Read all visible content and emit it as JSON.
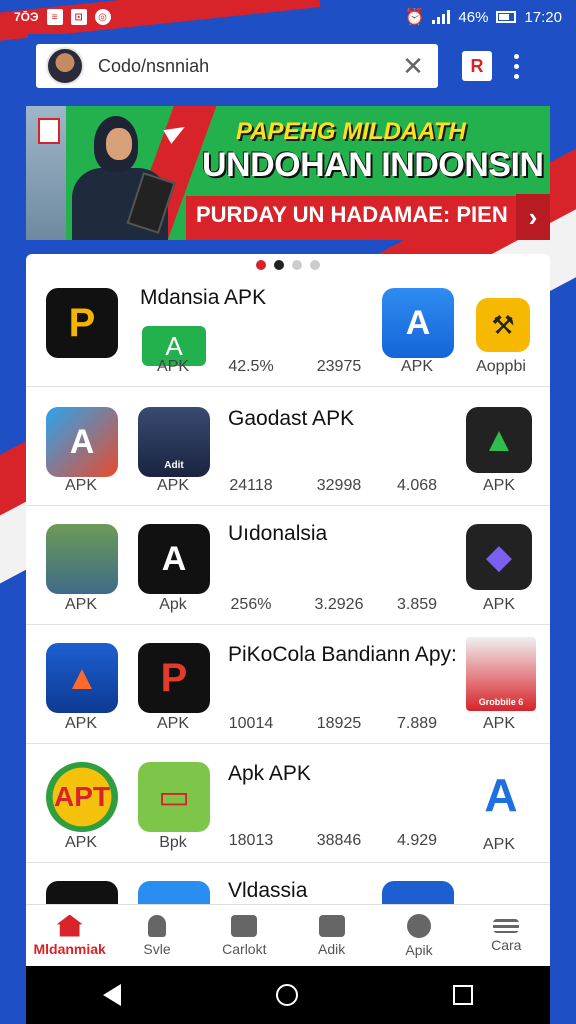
{
  "status_bar": {
    "left_icons": [
      "7ŌЭ",
      "≡",
      "⊡",
      "◎"
    ],
    "battery": "46%",
    "time": "17:20"
  },
  "search": {
    "value": "Codo/nsnniah"
  },
  "banner": {
    "line1": "PAPEHG MILDAATH",
    "line2": "UNDOHAN INDONSIN",
    "line3": "PURDAY UN HADAMAE: PIEN"
  },
  "rows": [
    {
      "title": "Mdansia  APK",
      "left_icon": "p-logo-icon",
      "captions": [
        "APK",
        "APK",
        "Aoppbi"
      ],
      "stats": [
        "42.5%",
        "23975"
      ]
    },
    {
      "title": "Gaodast APK",
      "captions": [
        "APK",
        "APK",
        "APK"
      ],
      "person_label": "Adit",
      "stats": [
        "24118",
        "32998",
        "4.068"
      ]
    },
    {
      "title": "Uıdonalsia",
      "captions": [
        "APK",
        "Apk",
        "APK"
      ],
      "stats": [
        "256%",
        "3.2926",
        "3.859"
      ]
    },
    {
      "title": "PiKoCola Bandiann Apy:",
      "captions": [
        "APK",
        "APK",
        "APK"
      ],
      "person_label": "Grobbile 6",
      "stats": [
        "10014",
        "18925",
        "7.889"
      ]
    },
    {
      "title": "Apk APK",
      "icon_text": "APT",
      "captions": [
        "APK",
        "Bpk",
        "APK"
      ],
      "stats": [
        "18013",
        "38846",
        "4.929"
      ]
    },
    {
      "title": "Vldassia"
    }
  ],
  "bottom_nav": [
    {
      "label": "Mldanmiak",
      "icon": "home-icon"
    },
    {
      "label": "Svle",
      "icon": "lock-icon"
    },
    {
      "label": "Carlokt",
      "icon": "cart-icon"
    },
    {
      "label": "Adik",
      "icon": "swap-icon"
    },
    {
      "label": "Apik",
      "icon": "globe-icon"
    },
    {
      "label": "Cara",
      "icon": "menu-icon"
    }
  ],
  "colors": {
    "primary_blue": "#1e4fc4",
    "accent_red": "#d8232a",
    "banner_green": "#22b14c"
  }
}
